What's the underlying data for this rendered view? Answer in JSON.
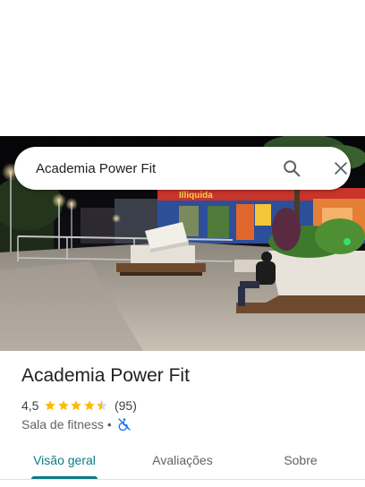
{
  "search": {
    "query": "Academia Power Fit"
  },
  "photo": {
    "storefront_sign": "Illiquida",
    "description_icon": "street-photo"
  },
  "place": {
    "title": "Academia Power Fit",
    "rating": "4,5",
    "stars_filled": 4.5,
    "review_count": "(95)",
    "category": "Sala de fitness",
    "separator": "•",
    "accessibility_icon": "wheelchair-not-accessible-icon"
  },
  "tabs": [
    {
      "label": "Visão geral",
      "active": true
    },
    {
      "label": "Avaliações",
      "active": false
    },
    {
      "label": "Sobre",
      "active": false
    }
  ],
  "colors": {
    "accent": "#0b7a85",
    "star": "#fbbc04",
    "accessibility_blue": "#1a73e8"
  }
}
